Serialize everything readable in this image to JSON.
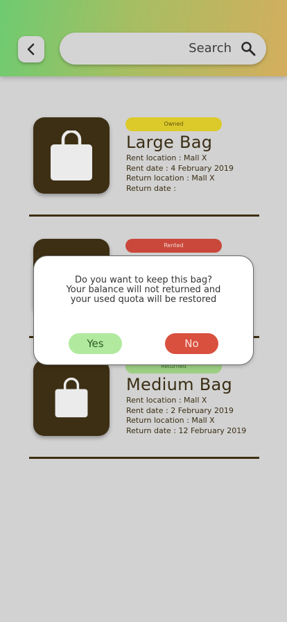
{
  "header": {
    "search_placeholder": "Search",
    "accent_gradient": [
      "#6ecb71",
      "#d4ae5e"
    ]
  },
  "cards": [
    {
      "status": "Owned",
      "status_color": "#dcc92a",
      "title": "Large Bag",
      "rent_location": "Rent location : Mall X",
      "rent_date_prefix": "Rent date : ",
      "rent_date_strong": "4 February 2019",
      "return_location": "Return location : Mall X",
      "return_date": "Return date :"
    },
    {
      "status": "Rented",
      "status_color": "#c9483b"
    },
    {
      "status": "Returned",
      "status_color": "#9ccf83",
      "title": "Medium Bag",
      "rent_location": "Rent location : Mall X",
      "rent_date": "Rent date : 2 February 2019",
      "return_location": "Return location : Mall X",
      "return_date_prefix": "Return date : ",
      "return_date_strong": "12 February 2019"
    }
  ],
  "dialog": {
    "line1": "Do you want to keep this bag?",
    "line2": "Your balance will not returned and",
    "line3": "your used quota will be restored",
    "yes_label": "Yes",
    "no_label": "No"
  },
  "icons": {
    "back": "chevron-left-icon",
    "search": "magnifier-icon",
    "bag": "shopping-bag-icon"
  }
}
